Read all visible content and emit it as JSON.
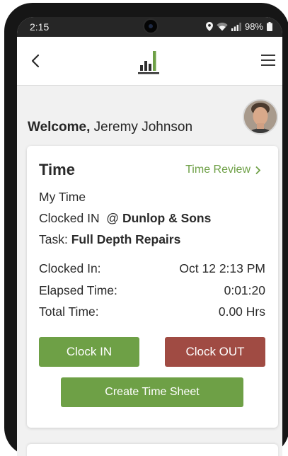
{
  "status_bar": {
    "time": "2:15",
    "battery_text": "98%",
    "icons": [
      "location-icon",
      "wifi-icon",
      "signal-icon",
      "battery-icon"
    ]
  },
  "app_bar": {
    "back_icon": "chevron-left-icon",
    "logo_icon": "bar-chart-logo",
    "menu_icon": "hamburger-menu-icon"
  },
  "welcome": {
    "greeting": "Welcome,",
    "user_name": "Jeremy Johnson"
  },
  "time_card": {
    "title": "Time",
    "review_link": "Time Review",
    "my_time": "My Time",
    "clocked_in_label": "Clocked IN  @",
    "clocked_in_location": "Dunlop & Sons",
    "task_label": "Task:",
    "task_value": "Full Depth Repairs",
    "rows": [
      {
        "label": "Clocked In:",
        "value": "Oct 12 2:13 PM"
      },
      {
        "label": "Elapsed Time:",
        "value": "0:01:20"
      },
      {
        "label": "Total Time:",
        "value": "0.00 Hrs"
      }
    ],
    "clock_in_button": "Clock IN",
    "clock_out_button": "Clock OUT",
    "create_sheet_button": "Create Time Sheet"
  },
  "colors": {
    "accent_green": "#6ea046",
    "clock_out_red": "#a04b43",
    "status_bar": "#262626"
  }
}
